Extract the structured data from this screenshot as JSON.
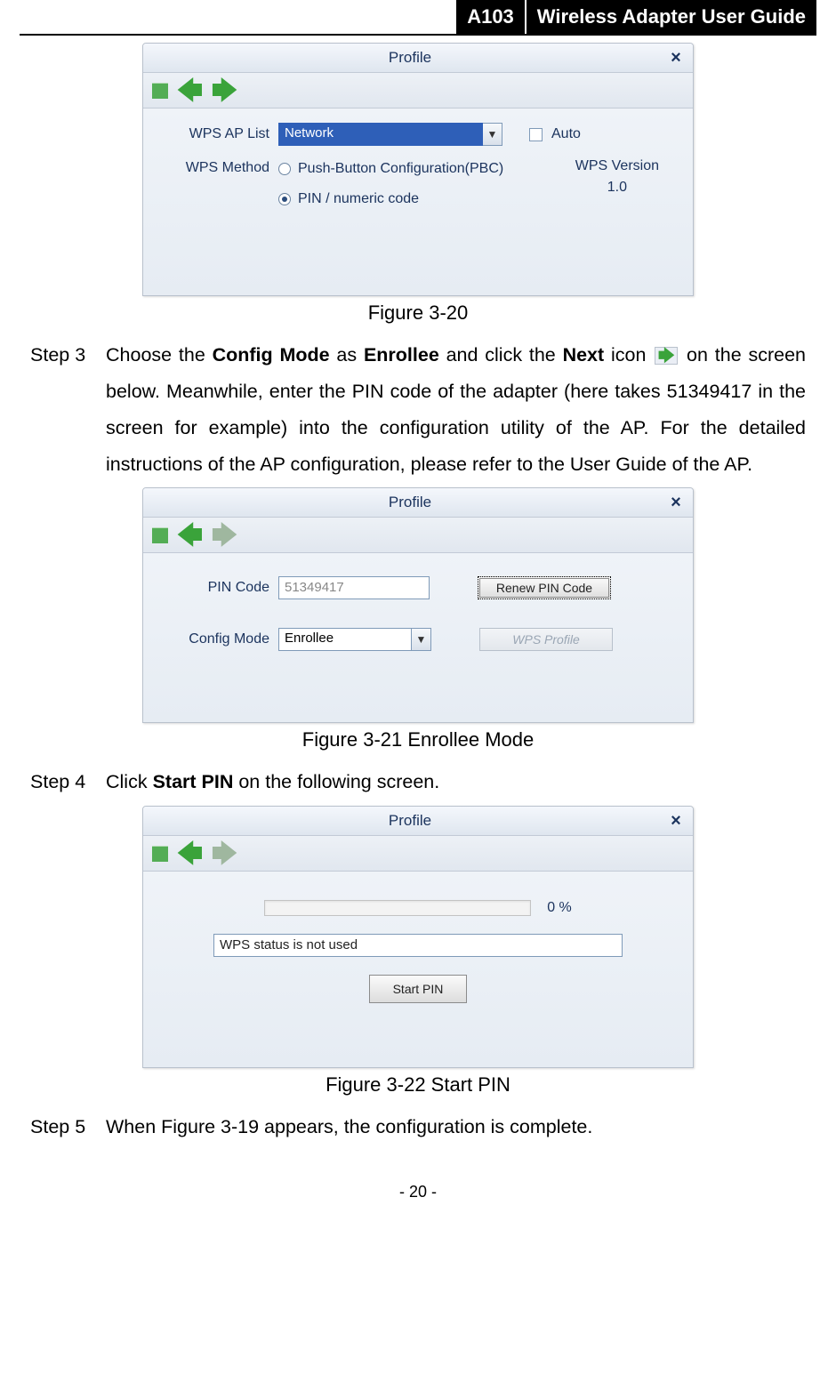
{
  "header": {
    "badge": "A103",
    "title": "Wireless Adapter User Guide"
  },
  "fig20": {
    "window_title": "Profile",
    "wps_ap_list_label": "WPS AP List",
    "wps_ap_list_value": "Network",
    "auto_label": "Auto",
    "wps_method_label": "WPS Method",
    "pbc_label": "Push-Button Configuration(PBC)",
    "pin_label": "PIN / numeric code",
    "wps_version_label": "WPS Version",
    "wps_version_value": "1.0",
    "caption": "Figure 3-20"
  },
  "step3": {
    "num": "Step 3",
    "t1": "Choose the ",
    "b1": "Config Mode",
    "t2": " as ",
    "b2": "Enrollee",
    "t3": " and click the ",
    "b3": "Next",
    "t4": " icon ",
    "t5": " on the screen below. Meanwhile, enter the PIN code of the adapter (here takes 51349417 in the screen for example) into the configuration utility of the AP. For the detailed instructions of the AP configuration, please refer to the User Guide of the AP."
  },
  "fig21": {
    "window_title": "Profile",
    "pin_code_label": "PIN Code",
    "pin_code_value": "51349417",
    "renew_btn": "Renew PIN Code",
    "config_mode_label": "Config Mode",
    "config_mode_value": "Enrollee",
    "wps_profile_btn": "WPS Profile",
    "caption": "Figure 3-21 Enrollee Mode"
  },
  "step4": {
    "num": "Step 4",
    "t1": "Click ",
    "b1": "Start PIN",
    "t2": " on the following screen."
  },
  "fig22": {
    "window_title": "Profile",
    "percent": "0 %",
    "status": "WPS status is not used",
    "start_btn": "Start PIN",
    "caption": "Figure 3-22 Start PIN"
  },
  "step5": {
    "num": "Step 5",
    "t1": "When Figure 3-19 appears, the configuration is complete."
  },
  "page_number": "- 20 -"
}
